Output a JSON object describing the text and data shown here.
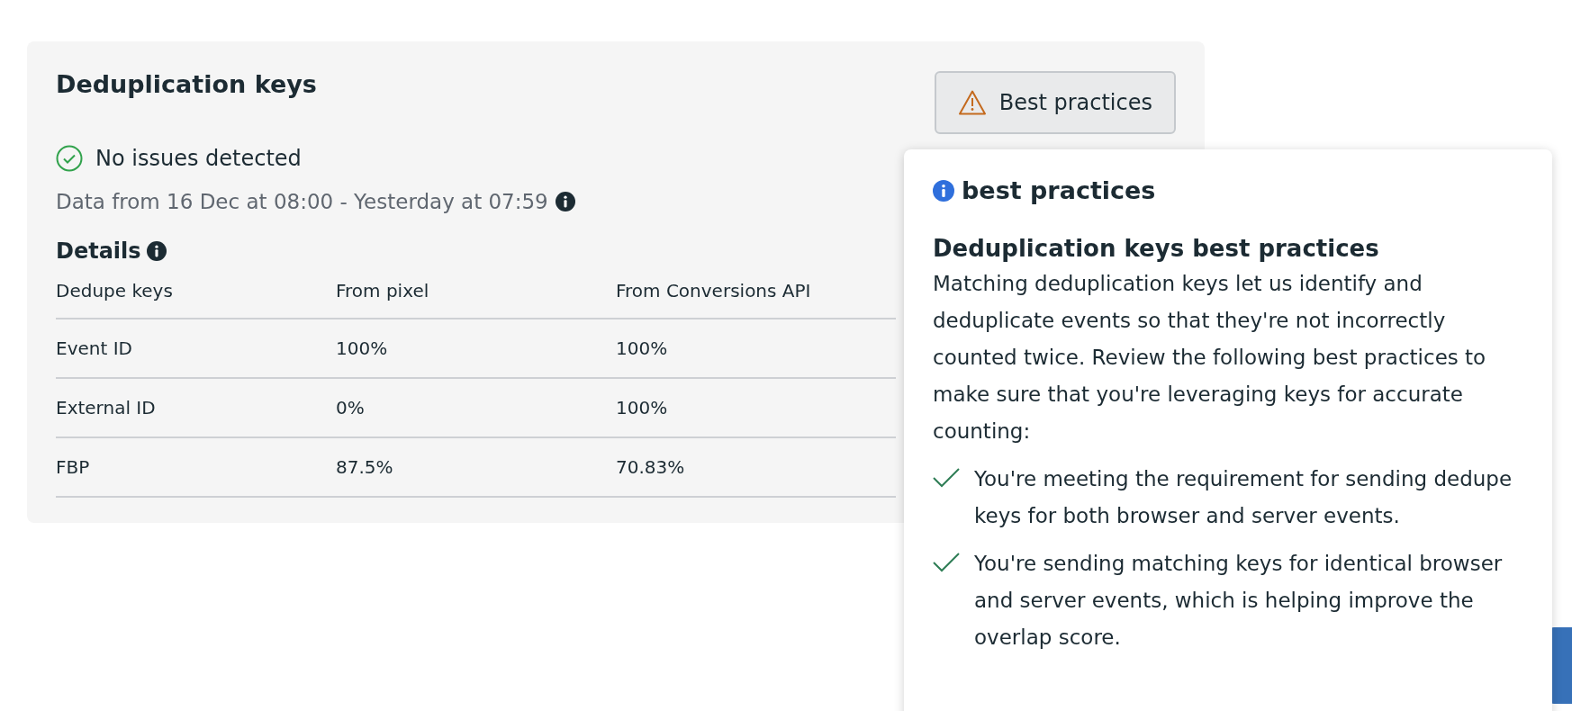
{
  "card": {
    "title": "Deduplication keys",
    "button": {
      "label": "Best practices"
    },
    "status": {
      "kind": "ok",
      "text": "No issues detected"
    },
    "date_range": "Data from 16 Dec at 08:00 - Yesterday at 07:59",
    "details_title": "Details",
    "table": {
      "columns": [
        "Dedupe keys",
        "From pixel",
        "From Conversions API"
      ],
      "rows": [
        [
          "Event ID",
          "100%",
          "100%"
        ],
        [
          "External ID",
          "0%",
          "100%"
        ],
        [
          "FBP",
          "87.5%",
          "70.83%"
        ]
      ]
    }
  },
  "popover": {
    "title": "best practices",
    "heading": "Deduplication keys best practices",
    "body": "Matching deduplication keys let us identify and deduplicate events so that they're not incorrectly counted twice. Review the following best practices to make sure that you're leveraging keys for accurate counting:",
    "items": [
      {
        "met": true,
        "text": "You're meeting the requirement for sending dedupe keys for both browser and server events."
      },
      {
        "met": true,
        "text": "You're sending matching keys for identical browser and server events, which is helping improve the overlap score."
      }
    ]
  }
}
